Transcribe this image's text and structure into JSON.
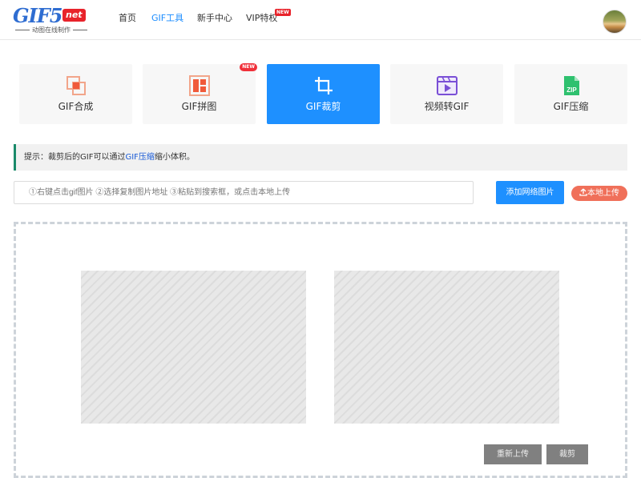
{
  "header": {
    "logo": {
      "main": "GIF5",
      "suffix": "net",
      "tagline": "动图在线制作"
    },
    "nav": [
      {
        "label": "首页"
      },
      {
        "label": "GIF工具"
      },
      {
        "label": "新手中心"
      },
      {
        "label": "VIP特权",
        "badge": "NEW"
      }
    ],
    "active_nav": "GIF工具"
  },
  "tools": [
    {
      "label": "GIF合成",
      "icon": "merge-icon"
    },
    {
      "label": "GIF拼图",
      "icon": "collage-icon",
      "badge": "NEW"
    },
    {
      "label": "GIF裁剪",
      "icon": "crop-icon",
      "active": true
    },
    {
      "label": "视频转GIF",
      "icon": "video-icon"
    },
    {
      "label": "GIF压缩",
      "icon": "zip-icon",
      "icon_text": "ZIP"
    }
  ],
  "tip": {
    "prefix": "提示：裁剪后的GIF可以通过",
    "link": "GIF压缩",
    "suffix": "缩小体积。"
  },
  "url_input": {
    "placeholder": "①右键点击gif图片 ②选择复制图片地址 ③粘贴到搜索框，或点击本地上传"
  },
  "add_button": "添加网络图片",
  "upload_button": "本地上传",
  "actions": {
    "reupload": "重新上传",
    "crop": "裁剪"
  },
  "colors": {
    "accent": "#1e90ff",
    "upload": "#f0705a",
    "badge": "#e8232b",
    "tip_border": "#1a8a6a"
  }
}
